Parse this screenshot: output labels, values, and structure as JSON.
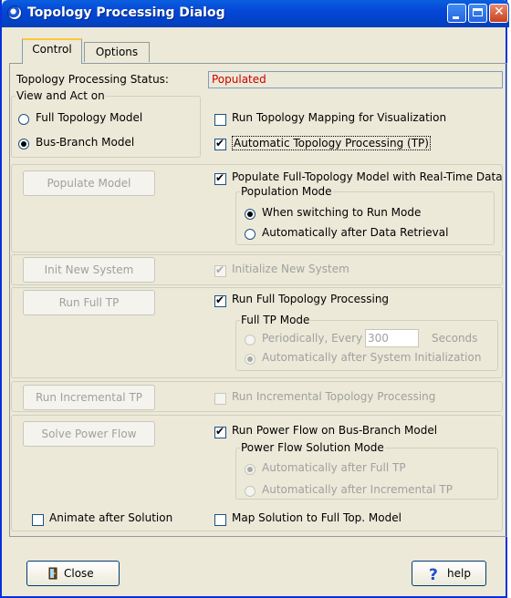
{
  "window": {
    "title": "Topology Processing Dialog"
  },
  "tabs": [
    {
      "label": "Control"
    },
    {
      "label": "Options"
    }
  ],
  "status": {
    "label": "Topology Processing Status:",
    "value": "Populated"
  },
  "view_group": {
    "legend": "View and Act on",
    "options": [
      {
        "label": "Full Topology Model",
        "selected": false
      },
      {
        "label": "Bus-Branch Model",
        "selected": true
      }
    ]
  },
  "top_checks": {
    "run_mapping": {
      "label": "Run Topology Mapping for Visualization",
      "checked": false
    },
    "auto_tp": {
      "label": "Automatic Topology Processing (TP)",
      "checked": true
    }
  },
  "populate": {
    "button": "Populate Model",
    "check_label": "Populate Full-Topology Model  with Real-Time Data",
    "checked": true,
    "mode_legend": "Population Mode",
    "modes": [
      {
        "label": "When switching to Run Mode",
        "selected": true
      },
      {
        "label": "Automatically after Data Retrieval",
        "selected": false
      }
    ]
  },
  "init": {
    "button": "Init New System",
    "check_label": "Initialize New System",
    "checked": true
  },
  "full_tp": {
    "button": "Run Full TP",
    "check_label": "Run Full Topology Processing",
    "checked": true,
    "mode_legend": "Full TP Mode",
    "periodic_label": "Periodically, Every",
    "period_value": "300",
    "period_unit": "Seconds",
    "auto_label": "Automatically after System Initialization"
  },
  "incr_tp": {
    "button": "Run Incremental TP",
    "check_label": "Run Incremental Topology Processing",
    "checked": false
  },
  "power_flow": {
    "button": "Solve Power Flow",
    "check_label": "Run Power Flow on Bus-Branch Model",
    "checked": true,
    "mode_legend": "Power Flow Solution Mode",
    "modes": [
      {
        "label": "Automatically after Full TP",
        "selected": true
      },
      {
        "label": "Automatically after Incremental TP",
        "selected": false
      }
    ]
  },
  "bottom_checks": {
    "animate": {
      "label": "Animate after Solution",
      "checked": false
    },
    "map_solution": {
      "label": "Map Solution to Full Top. Model",
      "checked": false
    }
  },
  "footer": {
    "close_label": "Close",
    "help_label": "help"
  },
  "icons": {
    "app": "app-globe-icon",
    "close": "door-exit-icon",
    "help": "question-mark-icon"
  }
}
